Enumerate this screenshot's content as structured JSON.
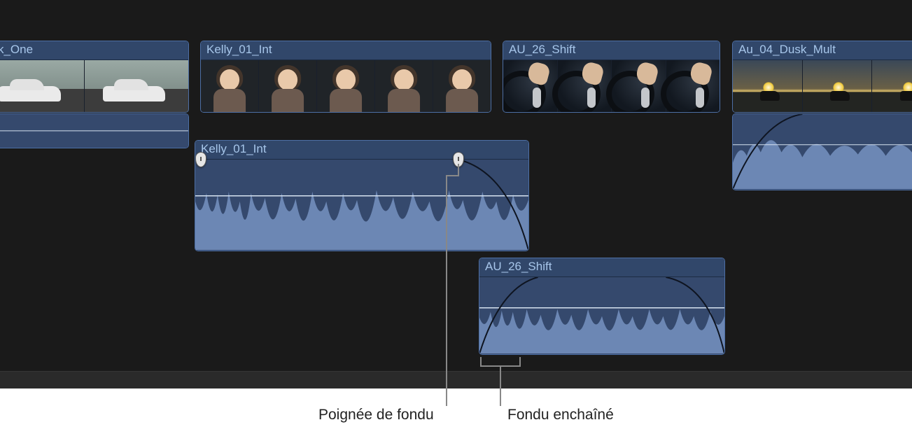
{
  "clips": {
    "c1": {
      "name": "usk_One"
    },
    "c2": {
      "name": "Kelly_01_Int"
    },
    "c3": {
      "name": "AU_26_Shift"
    },
    "c4": {
      "name": "Au_04_Dusk_Mult"
    },
    "a1": {
      "name": "Kelly_01_Int"
    },
    "a2": {
      "name": "AU_26_Shift"
    }
  },
  "annotations": {
    "fade_handle": "Poignée de fondu",
    "crossfade": "Fondu enchaîné"
  },
  "colors": {
    "clip_bg": "#35496d",
    "label_bg": "#31476a",
    "label_fg": "#a7c6ea",
    "timeline_bg": "#1a1a1a"
  }
}
